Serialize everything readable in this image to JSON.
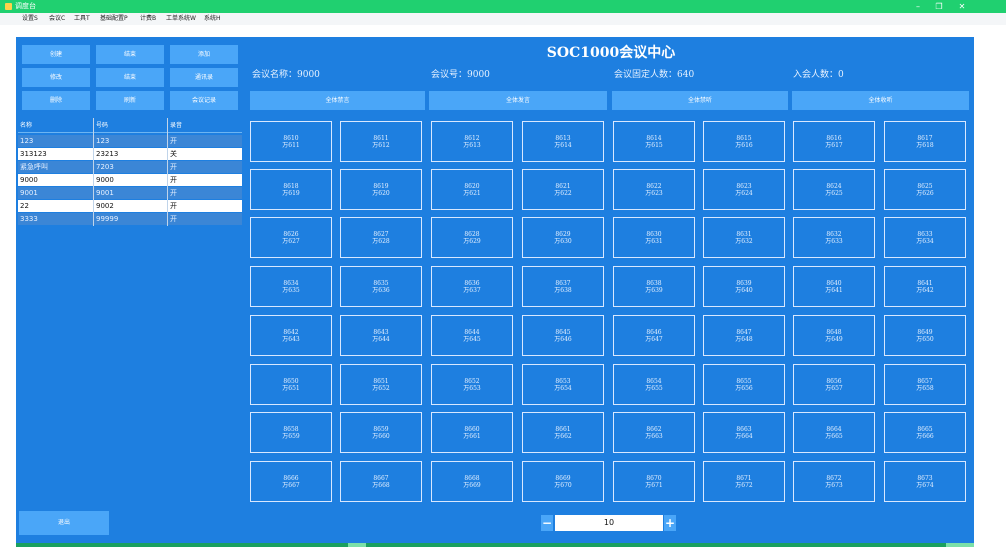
{
  "window": {
    "title": "调度台",
    "controls": {
      "minimize": "–",
      "maximize": "❐",
      "close": "✕"
    }
  },
  "menu": [
    "设置S",
    "会议C",
    "工具T",
    "基础配置P",
    "计费B",
    "工单系统W",
    "系统H"
  ],
  "left_buttons": [
    "创建",
    "结束",
    "添加",
    "修改",
    "结束",
    "通讯录",
    "删除",
    "刷新",
    "会议记录"
  ],
  "meeting_list": {
    "columns": [
      "名称",
      "号码",
      "录音"
    ],
    "rows": [
      {
        "name": "123",
        "number": "123",
        "record": "开"
      },
      {
        "name": "313123",
        "number": "23213",
        "record": "关"
      },
      {
        "name": "紧急呼叫",
        "number": "7203",
        "record": "开"
      },
      {
        "name": "9000",
        "number": "9000",
        "record": "开"
      },
      {
        "name": "9001",
        "number": "9001",
        "record": "开"
      },
      {
        "name": "22",
        "number": "9002",
        "record": "开"
      },
      {
        "name": "3333",
        "number": "99999",
        "record": "开"
      }
    ]
  },
  "header": {
    "title": "SOC1000会议中心",
    "info": [
      "会议名称：9000",
      "会议号：9000",
      "会议固定人数：640",
      "入会人数：0"
    ]
  },
  "top_buttons": [
    "全体禁言",
    "全体发言",
    "全体禁听",
    "全体收听"
  ],
  "tiles": [
    {
      "num": "8610",
      "sub": "万611"
    },
    {
      "num": "8611",
      "sub": "万612"
    },
    {
      "num": "8612",
      "sub": "万613"
    },
    {
      "num": "8613",
      "sub": "万614"
    },
    {
      "num": "8614",
      "sub": "万615"
    },
    {
      "num": "8615",
      "sub": "万616"
    },
    {
      "num": "8616",
      "sub": "万617"
    },
    {
      "num": "8617",
      "sub": "万618"
    },
    {
      "num": "8618",
      "sub": "万619"
    },
    {
      "num": "8619",
      "sub": "万620"
    },
    {
      "num": "8620",
      "sub": "万621"
    },
    {
      "num": "8621",
      "sub": "万622"
    },
    {
      "num": "8622",
      "sub": "万623"
    },
    {
      "num": "8623",
      "sub": "万624"
    },
    {
      "num": "8624",
      "sub": "万625"
    },
    {
      "num": "8625",
      "sub": "万626"
    },
    {
      "num": "8626",
      "sub": "万627"
    },
    {
      "num": "8627",
      "sub": "万628"
    },
    {
      "num": "8628",
      "sub": "万629"
    },
    {
      "num": "8629",
      "sub": "万630"
    },
    {
      "num": "8630",
      "sub": "万631"
    },
    {
      "num": "8631",
      "sub": "万632"
    },
    {
      "num": "8632",
      "sub": "万633"
    },
    {
      "num": "8633",
      "sub": "万634"
    },
    {
      "num": "8634",
      "sub": "万635"
    },
    {
      "num": "8635",
      "sub": "万636"
    },
    {
      "num": "8636",
      "sub": "万637"
    },
    {
      "num": "8637",
      "sub": "万638"
    },
    {
      "num": "8638",
      "sub": "万639"
    },
    {
      "num": "8639",
      "sub": "万640"
    },
    {
      "num": "8640",
      "sub": "万641"
    },
    {
      "num": "8641",
      "sub": "万642"
    },
    {
      "num": "8642",
      "sub": "万643"
    },
    {
      "num": "8643",
      "sub": "万644"
    },
    {
      "num": "8644",
      "sub": "万645"
    },
    {
      "num": "8645",
      "sub": "万646"
    },
    {
      "num": "8646",
      "sub": "万647"
    },
    {
      "num": "8647",
      "sub": "万648"
    },
    {
      "num": "8648",
      "sub": "万649"
    },
    {
      "num": "8649",
      "sub": "万650"
    },
    {
      "num": "8650",
      "sub": "万651"
    },
    {
      "num": "8651",
      "sub": "万652"
    },
    {
      "num": "8652",
      "sub": "万653"
    },
    {
      "num": "8653",
      "sub": "万654"
    },
    {
      "num": "8654",
      "sub": "万655"
    },
    {
      "num": "8655",
      "sub": "万656"
    },
    {
      "num": "8656",
      "sub": "万657"
    },
    {
      "num": "8657",
      "sub": "万658"
    },
    {
      "num": "8658",
      "sub": "万659"
    },
    {
      "num": "8659",
      "sub": "万660"
    },
    {
      "num": "8660",
      "sub": "万661"
    },
    {
      "num": "8661",
      "sub": "万662"
    },
    {
      "num": "8662",
      "sub": "万663"
    },
    {
      "num": "8663",
      "sub": "万664"
    },
    {
      "num": "8664",
      "sub": "万665"
    },
    {
      "num": "8665",
      "sub": "万666"
    },
    {
      "num": "8666",
      "sub": "万667"
    },
    {
      "num": "8667",
      "sub": "万668"
    },
    {
      "num": "8668",
      "sub": "万669"
    },
    {
      "num": "8669",
      "sub": "万670"
    },
    {
      "num": "8670",
      "sub": "万671"
    },
    {
      "num": "8671",
      "sub": "万672"
    },
    {
      "num": "8672",
      "sub": "万673"
    },
    {
      "num": "8673",
      "sub": "万674"
    }
  ],
  "footer": {
    "exit_label": "退出",
    "stepper_minus": "−",
    "stepper_plus": "+",
    "stepper_value": "10"
  },
  "colors": {
    "main_bg": "#1e7fe0",
    "button_bg": "#4aa6f8",
    "titlebar": "#20d070"
  }
}
